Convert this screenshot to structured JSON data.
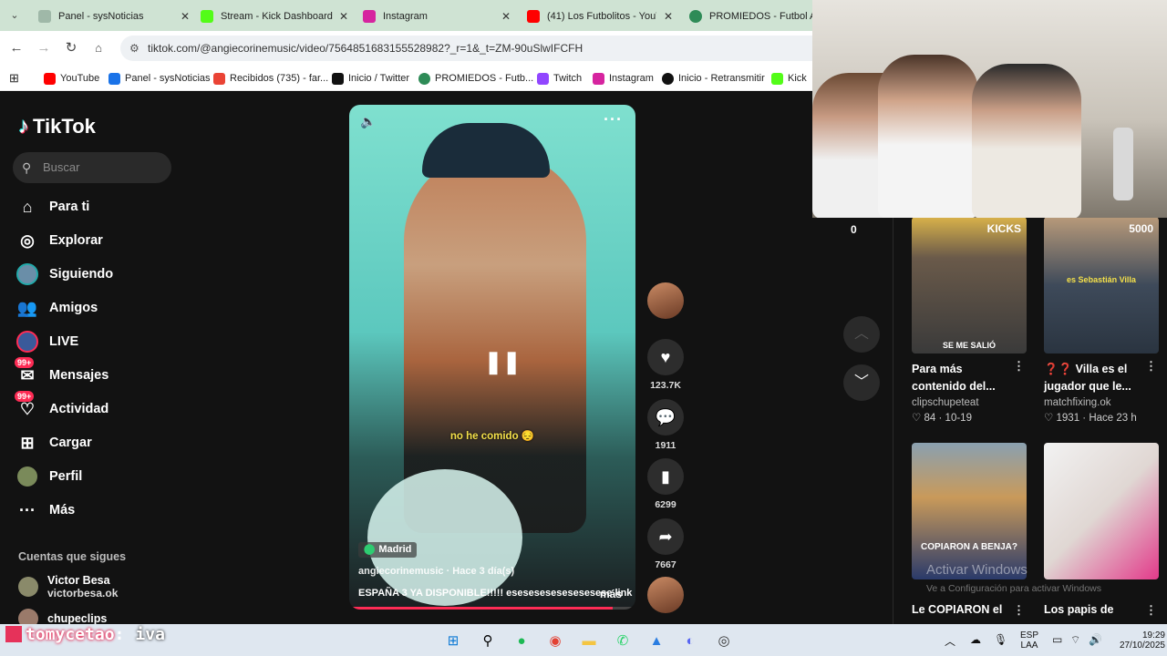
{
  "browser": {
    "tabs": [
      {
        "title": "Panel - sysNoticias",
        "color": "#6b8f7a",
        "active": false
      },
      {
        "title": "Stream - Kick Dashboard",
        "color": "#53fc18",
        "active": false
      },
      {
        "title": "Instagram",
        "color": "#d6249f",
        "active": false
      },
      {
        "title": "(41) Los Futbolitos - YouTu",
        "color": "#ff0000",
        "active": false
      },
      {
        "title": "PROMIEDOS - Futbol Arg",
        "color": "#2e8b57",
        "active": false
      }
    ],
    "url": "tiktok.com/@angiecorinemusic/video/7564851683155528982?_r=1&_t=ZM-90uSlwIFCFH",
    "bookmarks": [
      {
        "label": "YouTube",
        "color": "#ff0000"
      },
      {
        "label": "Panel - sysNoticias",
        "color": "#1a73e8"
      },
      {
        "label": "Recibidos (735) - far...",
        "color": "#ea4335"
      },
      {
        "label": "Inicio / Twitter",
        "color": "#111111"
      },
      {
        "label": "PROMIEDOS - Futb...",
        "color": "#2e8b57"
      },
      {
        "label": "Twitch",
        "color": "#9146ff"
      },
      {
        "label": "Instagram",
        "color": "#d6249f"
      },
      {
        "label": "Inicio - Retransmitir",
        "color": "#111111"
      },
      {
        "label": "Kick",
        "color": "#53fc18"
      }
    ]
  },
  "tiktok": {
    "brand": "TikTok",
    "search_placeholder": "Buscar",
    "nav": [
      {
        "label": "Para ti",
        "icon": "home-icon"
      },
      {
        "label": "Explorar",
        "icon": "compass-icon"
      },
      {
        "label": "Siguiendo",
        "icon": "following-avatar-icon"
      },
      {
        "label": "Amigos",
        "icon": "friends-icon"
      },
      {
        "label": "LIVE",
        "icon": "live-icon"
      },
      {
        "label": "Mensajes",
        "icon": "messages-icon",
        "badge": "99+"
      },
      {
        "label": "Actividad",
        "icon": "activity-icon",
        "badge": "99+"
      },
      {
        "label": "Cargar",
        "icon": "upload-icon"
      },
      {
        "label": "Perfil",
        "icon": "profile-icon"
      },
      {
        "label": "Más",
        "icon": "more-icon"
      }
    ],
    "following_title": "Cuentas que sigues",
    "following": [
      {
        "name": "Victor Besa",
        "handle": "victorbesa.ok"
      },
      {
        "name": "chupeclips",
        "handle": ""
      }
    ],
    "video": {
      "subtitle": "no he comido 😔",
      "location": "Madrid",
      "author_time": "angiecorinemusic · Hace 3 día(s)",
      "description": "ESPAÑA 3 YA DISPONIBLE!!!!! esesesesesesesesese link ...",
      "more": "más",
      "progress": 0.92
    },
    "actions": {
      "likes": "123.7K",
      "comments": "1911",
      "saves": "6299",
      "shares": "7667"
    },
    "recommended": [
      {
        "title": "Para más contenido del...",
        "user": "clipschupeteat",
        "likes": "84",
        "date": "10-19",
        "thumb_text": "KICKS",
        "thumb_bottom": "SE ME SALIÓ"
      },
      {
        "title": "❓❓ Villa es el jugador que le...",
        "user": "matchfixing.ok",
        "likes": "1931",
        "date": "Hace 23 h",
        "thumb_text": "5000",
        "thumb_bottom": "es Sebastián Villa"
      },
      {
        "title": "Le COPIARON el",
        "user": "",
        "likes": "",
        "date": "",
        "thumb_text": "",
        "thumb_bottom": "COPIARON A BENJA?"
      },
      {
        "title": "Los papis de",
        "user": "",
        "likes": "",
        "date": "",
        "thumb_text": "",
        "thumb_bottom": ""
      }
    ]
  },
  "webcam": {
    "counter": "0"
  },
  "windows_watermark": {
    "line1": "Activar Windows",
    "line2": "Ve a Configuración para activar Windows"
  },
  "stream_overlay": {
    "username": "tomycetao",
    "message": "iva",
    "color": "#e6325a"
  },
  "taskbar": {
    "lang_top": "ESP",
    "lang_bottom": "LAA",
    "time": "19:29",
    "date": "27/10/2025"
  }
}
